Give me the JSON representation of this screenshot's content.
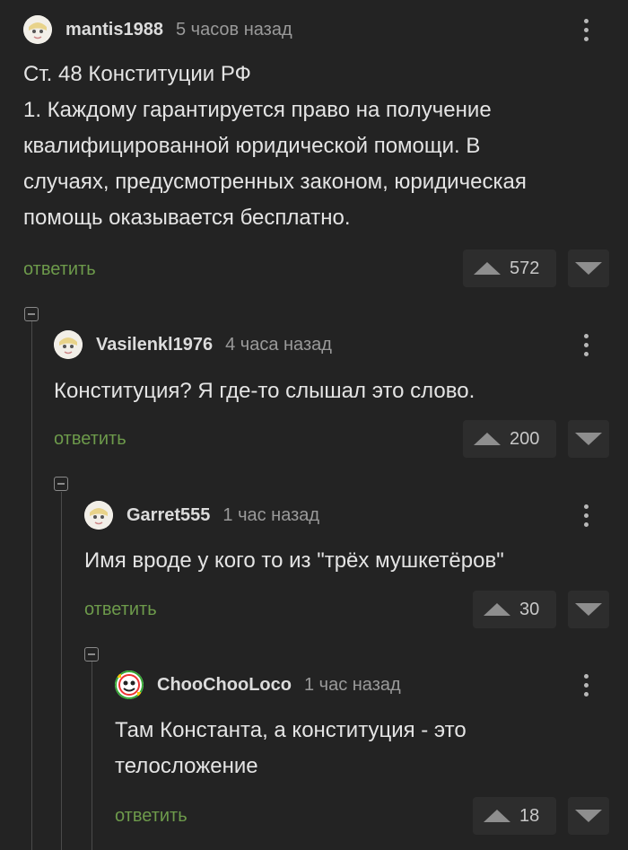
{
  "comments": [
    {
      "username": "mantis1988",
      "time": "5 часов назад",
      "lines": [
        "Ст. 48 Конституции РФ",
        "1. Каждому гарантируется право на получение",
        "квалифицированной юридической помощи. В",
        "случаях, предусмотренных законом, юридическая",
        "помощь оказывается бесплатно."
      ],
      "reply_label": "ответить",
      "rating": "572"
    },
    {
      "username": "Vasilenkl1976",
      "time": "4 часа назад",
      "lines": [
        "Конституция? Я где-то слышал это слово."
      ],
      "reply_label": "ответить",
      "rating": "200"
    },
    {
      "username": "Garret555",
      "time": "1 час назад",
      "lines": [
        "Имя вроде у кого то из \"трёх мушкетёров\""
      ],
      "reply_label": "ответить",
      "rating": "30"
    },
    {
      "username": "ChooChooLoco",
      "time": "1 час назад",
      "lines": [
        "Там Константа, а конституция - это",
        "телосложение"
      ],
      "reply_label": "ответить",
      "rating": "18"
    }
  ],
  "icons": {
    "avatar": "avatar-icon",
    "menu": "kebab-menu-icon",
    "upvote": "upvote-arrow-icon",
    "downvote": "downvote-arrow-icon",
    "collapse": "collapse-thread-icon"
  },
  "colors": {
    "background": "#232323",
    "reply_link": "#6d9a4b",
    "rating_box": "#2d2d2d"
  }
}
